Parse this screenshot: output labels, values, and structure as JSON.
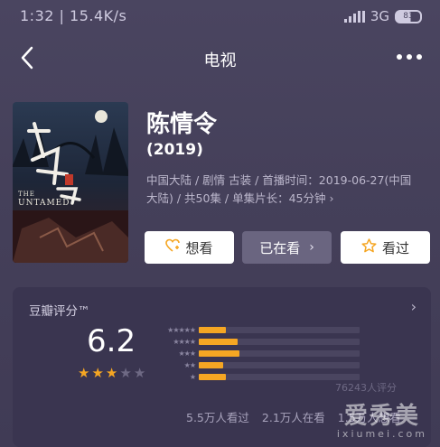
{
  "status": {
    "time": "1:32",
    "speed": "15.4K/s",
    "network": "3G",
    "battery": "83"
  },
  "nav": {
    "title": "电视"
  },
  "movie": {
    "title": "陈情令",
    "year": "(2019)",
    "meta_line1": "中国大陆 / 剧情 古装 / 首播时间：2019-06-27(中国",
    "meta_line2": "大陆) / 共50集 / 单集片长：45分钟 ›"
  },
  "actions": {
    "want": "想看",
    "watching": "已在看",
    "watched": "看过"
  },
  "rating": {
    "label": "豆瓣评分™",
    "score": "6.2",
    "stars_filled": 3,
    "distribution": [
      0.17,
      0.24,
      0.25,
      0.15,
      0.17
    ],
    "count": "76243人评分",
    "watched": "5.5万人看过",
    "watching": "2.1万人在看",
    "want": "1.5万人想看"
  },
  "watermark": {
    "line1": "爱秀美",
    "line2": "ixiumei.com"
  },
  "colors": {
    "accent": "#f5a623",
    "background": "#45405a"
  },
  "icons": [
    "back-icon",
    "more-icon",
    "heart-plus-icon",
    "chevron-right-icon",
    "star-outline-icon",
    "star-icon"
  ]
}
